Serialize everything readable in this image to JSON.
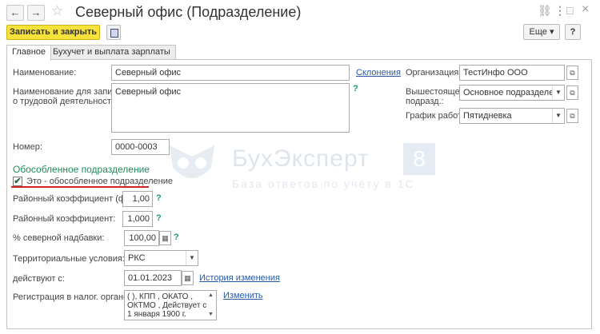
{
  "window": {
    "back_label": "←",
    "forward_label": "→",
    "star": "☆",
    "title": "Северный офис (Подразделение)",
    "link_icon": "🔗",
    "menu_icon": "⋮",
    "restore_icon": "□",
    "close_icon": "×"
  },
  "toolbar": {
    "save_close_label": "Записать и закрыть",
    "more_label": "Еще ▾",
    "help_label": "?"
  },
  "tabs": [
    {
      "label": "Главное",
      "active": true
    },
    {
      "label": "Бухучет и выплата зарплаты",
      "active": false
    }
  ],
  "form": {
    "name_label": "Наименование:",
    "name_value": "Северный офис",
    "declensions_link": "Склонения",
    "labor_name_label_1": "Наименование для записей",
    "labor_name_label_2": "о трудовой деятельности:",
    "labor_name_value": "Северный офис",
    "help_mark": "?",
    "number_label": "Номер:",
    "number_value": "0000-0003",
    "org_label": "Организация:",
    "org_value": "ТестИнфо ООО",
    "parent_label_1": "Вышестоящее",
    "parent_label_2": "подразд.:",
    "parent_value": "Основное подразделение",
    "schedule_label": "График работы:",
    "schedule_value": "Пятидневка"
  },
  "separate": {
    "section_title": "Обособленное подразделение",
    "checkbox_label": "Это - обособленное подразделение",
    "checked": true,
    "check_glyph": "✔",
    "regional_fed_label": "Районный коэффициент (фед.):",
    "regional_fed_value": "1,00",
    "regional_label": "Районный коэффициент:",
    "regional_value": "1,000",
    "north_label": "% северной надбавки:",
    "north_value": "100,00",
    "territorial_label": "Территориальные условия:",
    "territorial_value": "РКС",
    "valid_from_label": "действуют с:",
    "valid_from_value": "01.01.2023",
    "history_link": "История изменения",
    "tax_reg_label": "Регистрация в налог. органе:",
    "tax_reg_line1": "(    ), КПП , ОКАТО ,",
    "tax_reg_line2": "ОКТМО , Действует с",
    "tax_reg_line3": "1 января 1900 г.",
    "change_link": "Изменить"
  },
  "watermark": {
    "main": "БухЭксперт",
    "digit": "8",
    "sub": "База ответов по учёту в 1С"
  },
  "colors": {
    "accent_yellow": "#f7e23b",
    "section_green": "#1e8a5e",
    "link_blue": "#2959a6",
    "highlight_red": "#d42020"
  }
}
